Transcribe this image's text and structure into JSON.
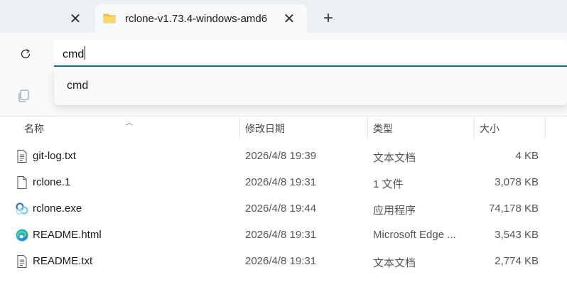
{
  "tabs": [
    {
      "title": "",
      "close_icon": "close-icon"
    },
    {
      "title": "rclone-v1.73.4-windows-amd6",
      "icon": "folder-icon",
      "close_icon": "close-icon",
      "active": true
    }
  ],
  "new_tab_icon": "plus-icon",
  "nav": {
    "refresh_icon": "refresh-icon",
    "address_value": "cmd"
  },
  "suggestions": [
    "cmd"
  ],
  "toolbar": {
    "copy_icon": "copy-icon"
  },
  "columns": {
    "name": "名称",
    "date": "修改日期",
    "type": "类型",
    "size": "大小"
  },
  "files": [
    {
      "name": "git-log.txt",
      "date": "2026/4/8 19:39",
      "type": "文本文档",
      "size": "4 KB",
      "icon": "text-file-icon"
    },
    {
      "name": "rclone.1",
      "date": "2026/4/8 19:31",
      "type": "1 文件",
      "size": "3,078 KB",
      "icon": "blank-file-icon"
    },
    {
      "name": "rclone.exe",
      "date": "2026/4/8 19:44",
      "type": "应用程序",
      "size": "74,178 KB",
      "icon": "rclone-app-icon"
    },
    {
      "name": "README.html",
      "date": "2026/4/8 19:31",
      "type": "Microsoft Edge ...",
      "size": "3,543 KB",
      "icon": "edge-icon"
    },
    {
      "name": "README.txt",
      "date": "2026/4/8 19:31",
      "type": "文本文档",
      "size": "2,774 KB",
      "icon": "text-file-icon"
    }
  ],
  "colors": {
    "accent": "#1e6f73",
    "tabbar_bg": "#eceff3",
    "folder": "#f7c948"
  }
}
